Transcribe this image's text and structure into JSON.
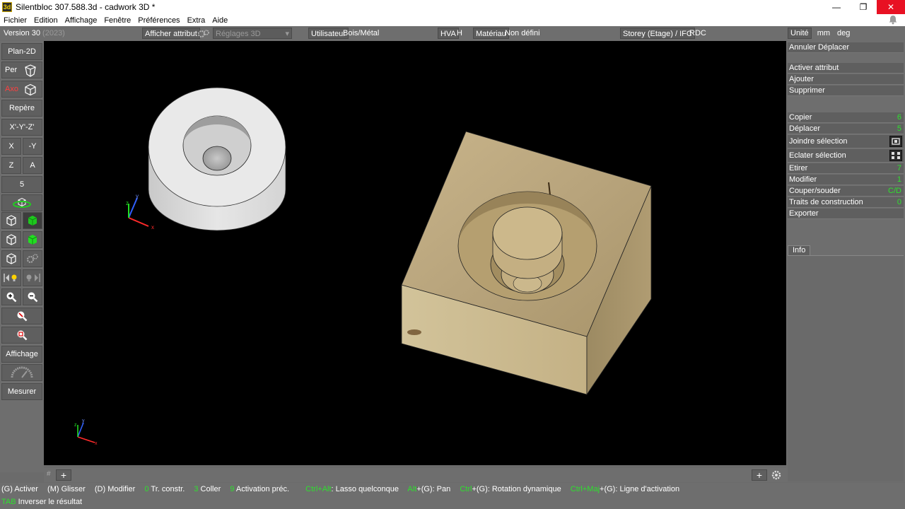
{
  "window": {
    "title": "Silentbloc 307.588.3d - cadwork 3D *",
    "icon_text": "3d",
    "minimize": "—",
    "restore": "❐",
    "close": "✕"
  },
  "menu": [
    "Fichier",
    "Edition",
    "Affichage",
    "Fenêtre",
    "Préférences",
    "Extra",
    "Aide"
  ],
  "toolbar": {
    "version": "Version 30",
    "version_year": "(2023)",
    "afficher_attribut": "Afficher attribut",
    "reglages": "Réglages 3D",
    "utilisateur": "Utilisateur",
    "utilisateur_value": "Bois/Métal",
    "hva": "HVA",
    "hva_value": "H",
    "materiau": "Matériau",
    "materiau_value": "Non défini",
    "storey": "Storey (Etage) / IFC",
    "storey_value": "RDC"
  },
  "left_panel": {
    "plan2d": "Plan-2D",
    "per": "Per",
    "axo": "Axo",
    "repere": "Repère",
    "xyz": "X'-Y'-Z'",
    "x": "X",
    "ny": "-Y",
    "z": "Z",
    "a": "A",
    "five": "5",
    "affichage": "Affichage",
    "mesurer": "Mesurer"
  },
  "right_panel": {
    "unit_label": "Unité",
    "unit_len": "mm",
    "unit_ang": "deg",
    "annuler": "Annuler Déplacer",
    "rows_top": [
      "Activer attribut",
      "Ajouter",
      "Supprimer"
    ],
    "rows": [
      {
        "label": "Copier",
        "key": "6"
      },
      {
        "label": "Déplacer",
        "key": "5"
      },
      {
        "label": "Joindre sélection",
        "key": ""
      },
      {
        "label": "Eclater sélection",
        "key": ""
      },
      {
        "label": "Etirer",
        "key": "7"
      },
      {
        "label": "Modifier",
        "key": "1"
      },
      {
        "label": "Couper/souder",
        "key": "C/D"
      },
      {
        "label": "Traits de construction",
        "key": "0"
      },
      {
        "label": "Exporter",
        "key": ""
      }
    ],
    "info_tab": "Info"
  },
  "tabstrip": {
    "hash": "#",
    "plus": "+",
    "plus_right": "+"
  },
  "status": {
    "line1": [
      {
        "k": "(G)",
        "t": " Activer"
      },
      {
        "k": "(M)",
        "t": " Glisser"
      },
      {
        "k": "(D)",
        "t": " Modifier"
      },
      {
        "k": "0",
        "t": " Tr. constr.",
        "green": true
      },
      {
        "k": "3",
        "t": " Coller",
        "green": true
      },
      {
        "k": "9",
        "t": " Activation préc.",
        "green": true
      },
      {
        "k": "Ctrl+Alt",
        "t": ": Lasso quelconque",
        "green": true
      },
      {
        "k": "Alt",
        "t": "+(G): Pan",
        "green": true
      },
      {
        "k": "Ctrl",
        "t": "+(G): Rotation dynamique",
        "green": true
      },
      {
        "k": "Ctrl+Maj",
        "t": "+(G): Ligne d'activation",
        "green": true
      }
    ],
    "line2_key": "TAB",
    "line2_text": " Inverser le résultat"
  },
  "axes": {
    "x": "x",
    "y": "y",
    "z": "z"
  }
}
